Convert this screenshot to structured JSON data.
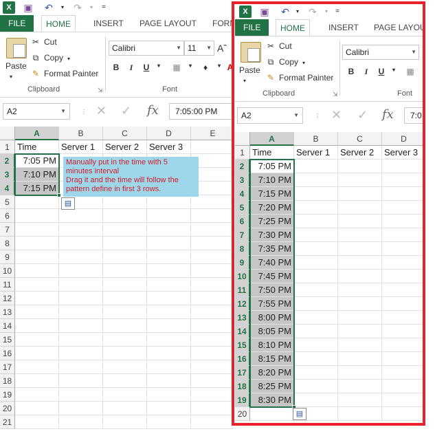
{
  "qat": {
    "logo": "X",
    "save_icon": "save-icon",
    "undo_icon": "undo-icon",
    "redo_icon": "redo-icon",
    "customize_glyph": "="
  },
  "tabs": [
    "FILE",
    "HOME",
    "INSERT",
    "PAGE LAYOUT",
    "FORM"
  ],
  "tabs_right": [
    "FILE",
    "HOME",
    "INSERT",
    "PAGE LAYOU"
  ],
  "clipboard": {
    "paste_label": "Paste",
    "cut_label": "Cut",
    "copy_label": "Copy",
    "format_painter_label": "Format Painter",
    "group_label": "Clipboard"
  },
  "font": {
    "name": "Calibri",
    "size": "11",
    "bold": "B",
    "italic": "I",
    "underline": "U",
    "group_label": "Font"
  },
  "formula_bar": {
    "name_box": "A2",
    "fx": "fx",
    "value": "7:05:00 PM",
    "value_right": "7:0"
  },
  "columns_left": [
    "A",
    "B",
    "C",
    "D",
    "E"
  ],
  "columns_right": [
    "A",
    "B",
    "C",
    "D"
  ],
  "header_row": [
    "Time",
    "Server 1",
    "Server 2",
    "Server 3"
  ],
  "rows_left": [
    "1",
    "2",
    "3",
    "4",
    "5",
    "6",
    "7",
    "8",
    "9",
    "10",
    "11",
    "12",
    "13",
    "14",
    "15",
    "16",
    "17",
    "18",
    "19",
    "20",
    "21"
  ],
  "times_left": [
    "7:05 PM",
    "7:10 PM",
    "7:15 PM"
  ],
  "rows_right": [
    "1",
    "2",
    "3",
    "4",
    "5",
    "6",
    "7",
    "8",
    "9",
    "10",
    "11",
    "12",
    "13",
    "14",
    "15",
    "16",
    "17",
    "18",
    "19",
    "20"
  ],
  "times_right": [
    "7:05 PM",
    "7:10 PM",
    "7:15 PM",
    "7:20 PM",
    "7:25 PM",
    "7:30 PM",
    "7:35 PM",
    "7:40 PM",
    "7:45 PM",
    "7:50 PM",
    "7:55 PM",
    "8:00 PM",
    "8:05 PM",
    "8:10 PM",
    "8:15 PM",
    "8:20 PM",
    "8:25 PM",
    "8:30 PM"
  ],
  "note": {
    "line1": "Manually put in the time with 5 minutes interval",
    "line2": "Drag it and the time will follow the pattern define in first 3 rows."
  },
  "colors": {
    "excel_green": "#217346",
    "note_bg": "#9ed7ea",
    "note_text": "#d41c2c",
    "frame_red": "#e8212a",
    "selection_fill": "#c6c6c6"
  }
}
